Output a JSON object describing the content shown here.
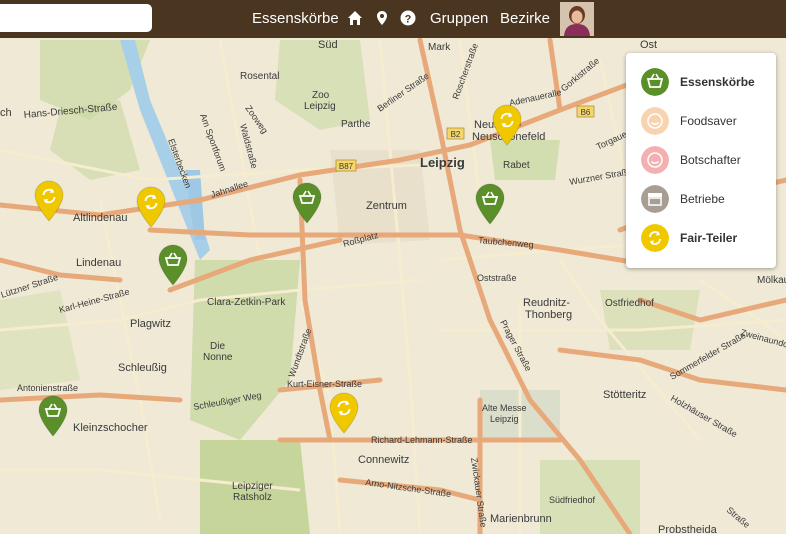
{
  "search": {
    "placeholder": "",
    "value": ""
  },
  "nav": {
    "baskets": "Essenskörbe",
    "home_icon": "home-icon",
    "location_icon": "map-marker-icon",
    "help_icon": "question-circle-icon",
    "groups": "Gruppen",
    "districts": "Bezirke"
  },
  "legend": {
    "items": [
      {
        "label": "Essenskörbe",
        "icon": "basket-icon",
        "color": "#5b8f29",
        "active": true
      },
      {
        "label": "Foodsaver",
        "icon": "smiley-icon",
        "color": "#f8d3b0",
        "active": false
      },
      {
        "label": "Botschafter",
        "icon": "smiley-icon",
        "color": "#f4b0b0",
        "active": false
      },
      {
        "label": "Betriebe",
        "icon": "store-icon",
        "color": "#a89e94",
        "active": false
      },
      {
        "label": "Fair-Teiler",
        "icon": "recycle-icon",
        "color": "#f0c800",
        "active": true
      }
    ]
  },
  "map": {
    "labels": {
      "ost": "Ost",
      "sud": "Süd",
      "mark": "Mark",
      "rosental": "Rosental",
      "zoo": "Zoo",
      "leipzig_zoo": "Leipzig",
      "parthe": "Parthe",
      "hans_driesch": "Hans-Driesch-Straße",
      "ch": "ch",
      "zoo_weg": "Zooweg",
      "sportforum": "Am Sportforum",
      "waldstrasse": "Waldstraße",
      "elsterbecken": "Elsterbecken",
      "berliner": "Berliner Straße",
      "roscher": "Roscherstraße",
      "adenauer": "Adenaueralle",
      "gorki": "Gorkistraße",
      "b6": "B6",
      "b2": "B2",
      "b87": "B87",
      "neustadt": "Neustadt-",
      "neuschoenefeld": "Neuschönefeld",
      "torgauer": "Torgauer",
      "rabet": "Rabet",
      "wurzner": "Wurzner Straße",
      "leipzig": "Leipzig",
      "jahnallee": "Jahnallee",
      "altlindenau": "Altlindenau",
      "zentrum": "Zentrum",
      "rosplatz": "Roßplatz",
      "taubchenweg": "Taubchenweg",
      "lindenau": "Lindenau",
      "lutzner": "Lützner Straße",
      "karl_heine": "Karl-Heine-Straße",
      "ostplatz": "Oststraße",
      "reudnitz1": "Reudnitz-",
      "reudnitz2": "Thonberg",
      "ostfriedhof": "Ostfriedhof",
      "molkau": "Mölkau",
      "zweinaundorfer": "Zweinaundorfer",
      "sommerfelder": "Sommerfelder Straße",
      "clara": "Clara-Zetkin-Park",
      "plagwitz": "Plagwitz",
      "die": "Die",
      "nonne": "Nonne",
      "wundt": "Wundtstraße",
      "prager": "Prager Straße",
      "schleussig": "Schleußig",
      "antonien": "Antonienstraße",
      "schleussiger_weg": "Schleußiger Weg",
      "kurt_eisner": "Kurt-Eisner-Straße",
      "alte_messe1": "Alte Messe",
      "alte_messe2": "Leipzig",
      "stotteritz": "Stötteritz",
      "holzhauser": "Holzhäuser Straße",
      "kleinzschocher": "Kleinzschocher",
      "richard": "Richard-Lehmann-Straße",
      "connewitz": "Connewitz",
      "arno": "Arno-Nitzsche-Straße",
      "zwickauer": "Zwickauer Straße",
      "sudfriedhof": "Südfriedhof",
      "leipziger": "Leipziger",
      "ratsholz": "Ratsholz",
      "marienbrunn": "Marienbrunn",
      "probstheida": "Probstheida",
      "strasse": "Straße"
    },
    "markers": [
      {
        "type": "fair-teiler",
        "label": ""
      },
      {
        "type": "fair-teiler",
        "label": ""
      },
      {
        "type": "fair-teiler",
        "label": ""
      },
      {
        "type": "fair-teiler",
        "label": ""
      },
      {
        "type": "essenskorb",
        "label": ""
      },
      {
        "type": "essenskorb",
        "label": ""
      },
      {
        "type": "essenskorb",
        "label": ""
      },
      {
        "type": "essenskorb",
        "label": ""
      }
    ]
  },
  "colors": {
    "topbar": "#4a3520",
    "basket_green": "#5b8f29",
    "fairteiler_yellow": "#f0c800",
    "road_major": "#e8a97a",
    "road_minor": "#f5e9c8",
    "park": "#c8d8a0",
    "water": "#a8cfe8"
  }
}
